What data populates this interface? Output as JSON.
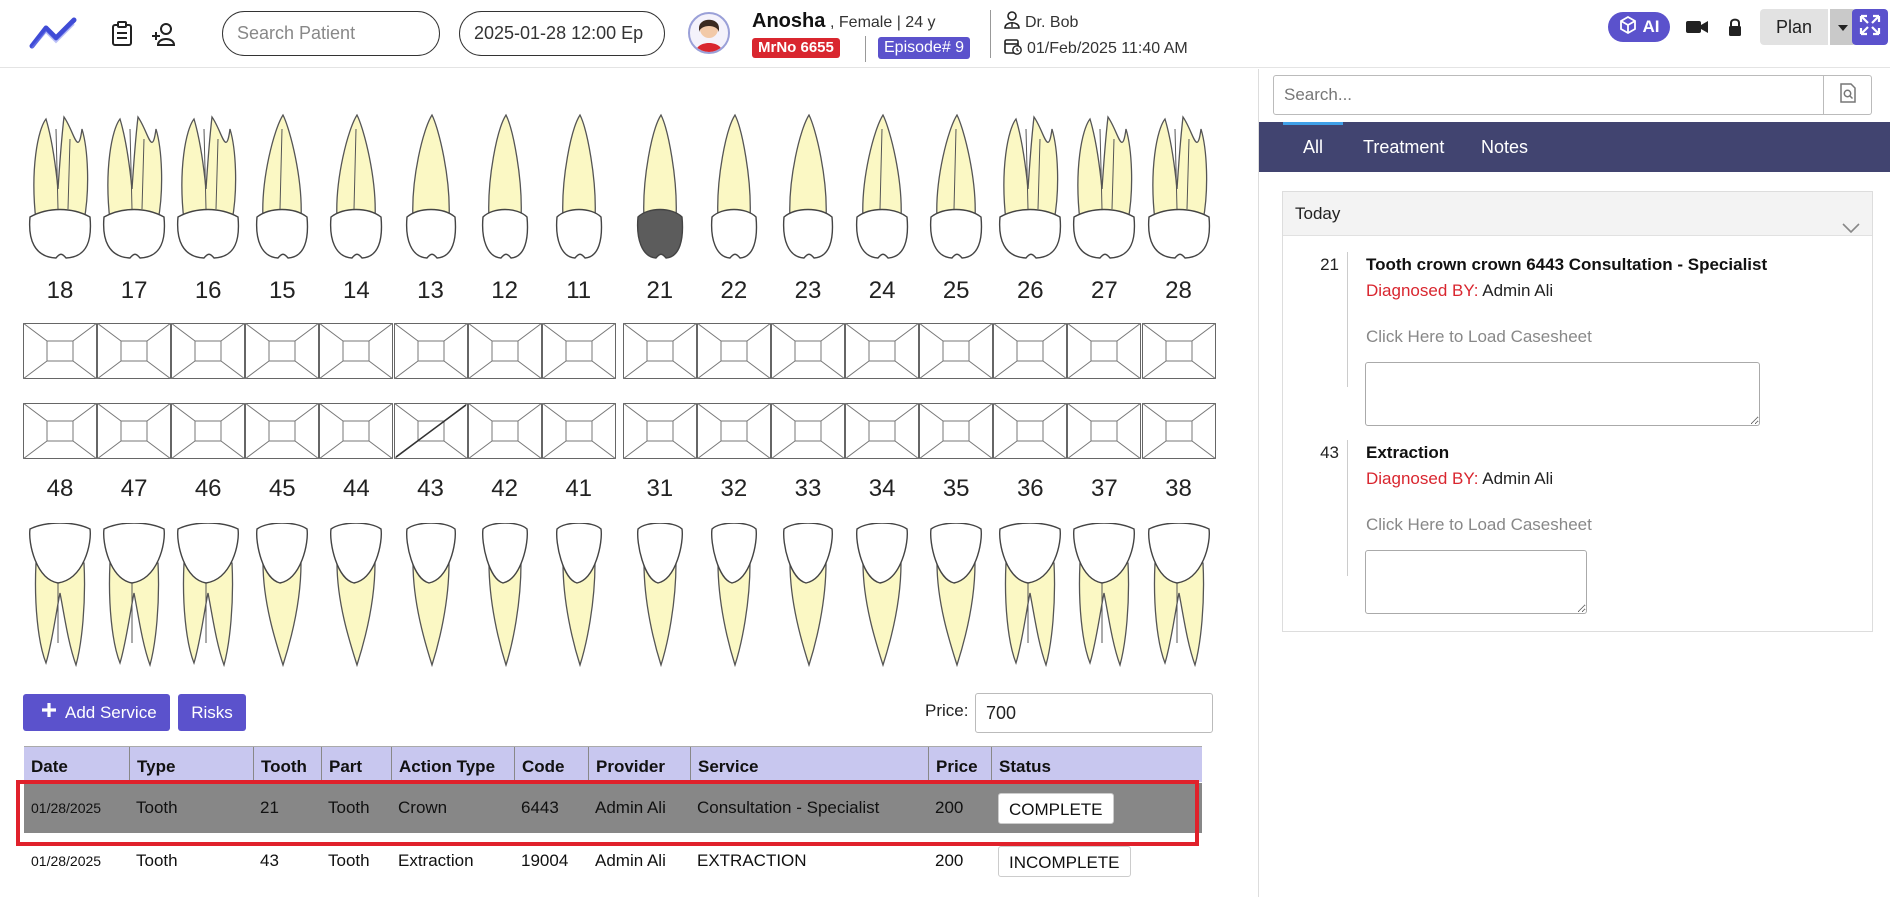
{
  "header": {
    "search_placeholder": "Search Patient",
    "episode_date": "2025-01-28 12:00 Ep",
    "patient": {
      "name": "Anosha",
      "meta": ", Female | 24 y",
      "mrno": "MrNo 6655",
      "episode": "Episode# 9"
    },
    "doctor": {
      "name": "Dr. Bob",
      "datetime": "01/Feb/2025 11:40 AM"
    },
    "ai_label": "AI",
    "plan_label": "Plan"
  },
  "chart": {
    "upper_teeth": [
      "18",
      "17",
      "16",
      "15",
      "14",
      "13",
      "12",
      "11",
      "21",
      "22",
      "23",
      "24",
      "25",
      "26",
      "27",
      "28"
    ],
    "lower_teeth": [
      "48",
      "47",
      "46",
      "45",
      "44",
      "43",
      "42",
      "41",
      "31",
      "32",
      "33",
      "34",
      "35",
      "36",
      "37",
      "38"
    ],
    "crowned_tooth": "21",
    "marked_surface_tooth": "43"
  },
  "services": {
    "add_label": "Add Service",
    "risks_label": "Risks",
    "price_label": "Price:",
    "price_value": "700"
  },
  "table": {
    "headers": [
      "Date",
      "Type",
      "Tooth",
      "Part",
      "Action Type",
      "Code",
      "Provider",
      "Service",
      "Price",
      "Status"
    ],
    "rows": [
      {
        "date": "01/28/2025",
        "type": "Tooth",
        "tooth": "21",
        "part": "Tooth",
        "action": "Crown",
        "code": "6443",
        "provider": "Admin Ali",
        "service": "Consultation - Specialist",
        "price": "200",
        "status": "COMPLETE"
      },
      {
        "date": "01/28/2025",
        "type": "Tooth",
        "tooth": "43",
        "part": "Tooth",
        "action": "Extraction",
        "code": "19004",
        "provider": "Admin Ali",
        "service": "EXTRACTION",
        "price": "200",
        "status": "INCOMPLETE"
      }
    ]
  },
  "right_panel": {
    "search_placeholder": "Search...",
    "tabs": [
      "All",
      "Treatment",
      "Notes"
    ],
    "section_title": "Today",
    "entries": [
      {
        "tooth": "21",
        "title": "Tooth crown crown 6443 Consultation - Specialist",
        "diag_label": "Diagnosed BY:",
        "diag_by": " Admin Ali",
        "load_text": "Click Here to Load Casesheet"
      },
      {
        "tooth": "43",
        "title": "Extraction",
        "diag_label": "Diagnosed BY:",
        "diag_by": " Admin Ali",
        "load_text": "Click Here to Load Casesheet"
      }
    ]
  },
  "colors": {
    "accent": "#5b52cc",
    "tab_bar": "#414470",
    "table_header": "#c8c7ef",
    "selected_row": "#878787",
    "highlight": "#e0212b",
    "tooth_root": "#fbf8c4"
  }
}
